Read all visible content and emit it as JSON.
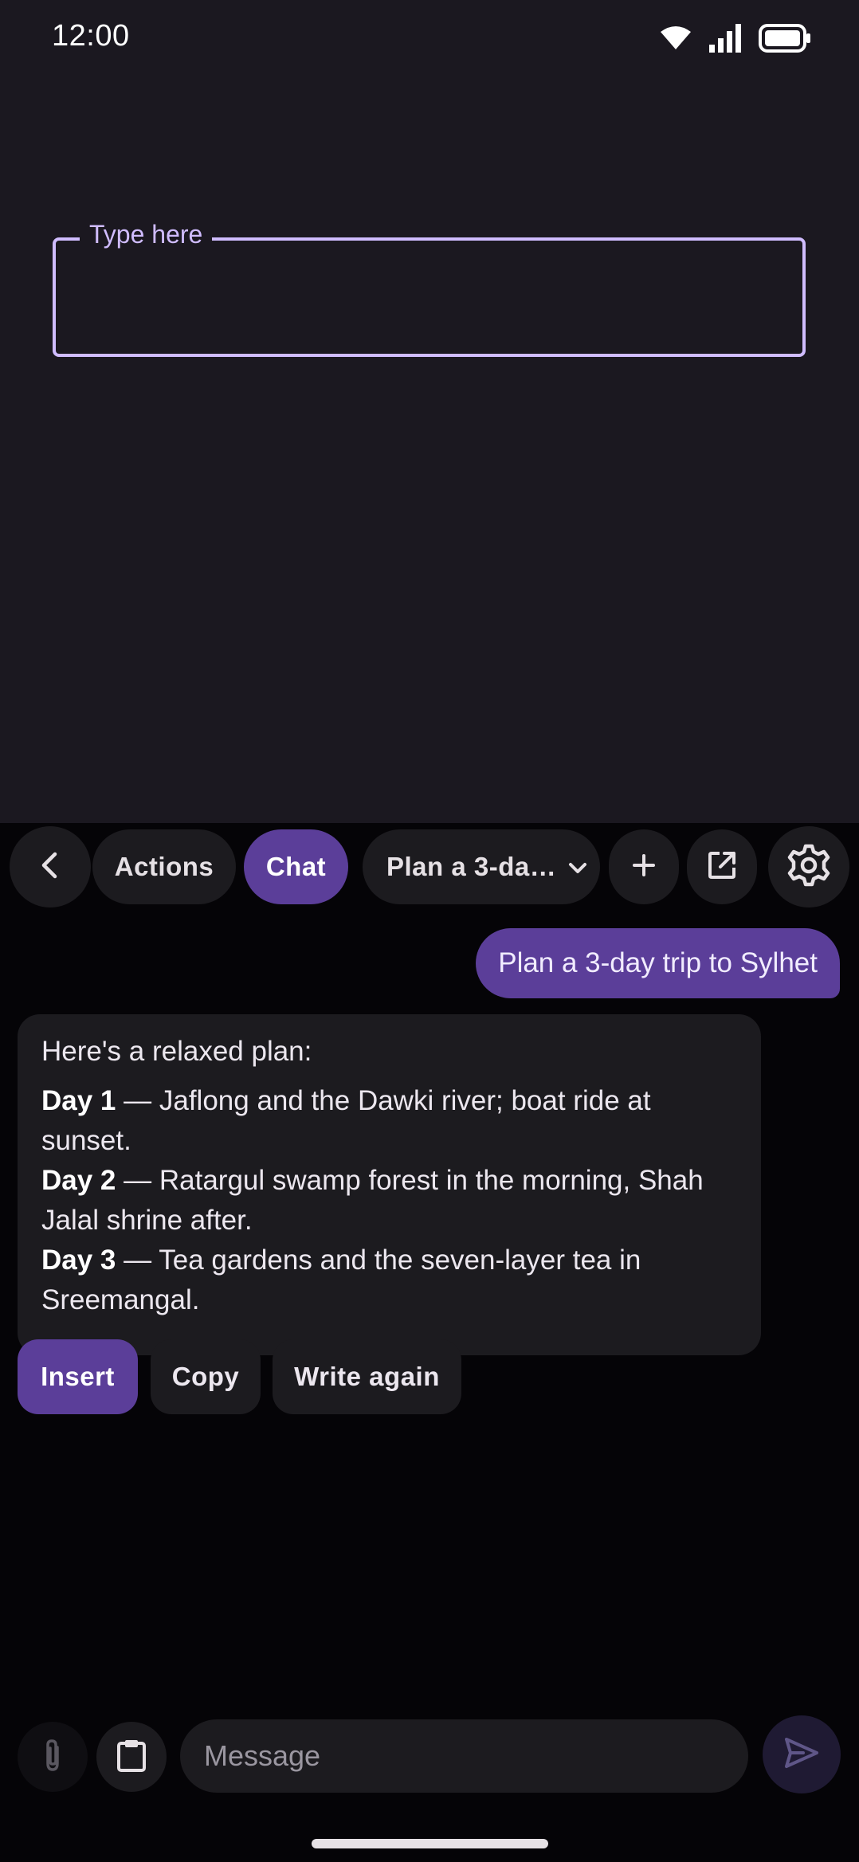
{
  "status_bar": {
    "time": "12:00"
  },
  "text_field": {
    "label": "Type here",
    "value": ""
  },
  "toolbar": {
    "actions_label": "Actions",
    "chat_label": "Chat",
    "conversation_title": "Plan a 3-da…"
  },
  "chat": {
    "user_message": "Plan a 3-day trip to Sylhet",
    "reply_intro": "Here's a relaxed plan:",
    "days": [
      {
        "label": "Day 1",
        "text": " — Jaflong and the Dawki river; boat ride at sunset."
      },
      {
        "label": "Day 2",
        "text": " — Ratargul swamp forest in the morning, Shah Jalal shrine after."
      },
      {
        "label": "Day 3",
        "text": " — Tea gardens and the seven-layer tea in Sreemangal."
      }
    ]
  },
  "reply_actions": {
    "insert_label": "Insert",
    "copy_label": "Copy",
    "write_again_label": "Write again"
  },
  "composer": {
    "placeholder": "Message",
    "value": ""
  },
  "colors": {
    "accent": "#5b3e99",
    "field_outline": "#d0bcff",
    "app_background": "#1b1820",
    "panel_background": "#050407",
    "surface": "#1c1b1f"
  },
  "icons": {
    "status": [
      "wifi-icon",
      "signal-icon",
      "battery-icon"
    ],
    "toolbar": [
      "back-icon",
      "chevron-down-icon",
      "plus-icon",
      "open-external-icon",
      "gear-icon"
    ],
    "composer": [
      "paperclip-icon",
      "clipboard-icon",
      "send-icon"
    ]
  }
}
